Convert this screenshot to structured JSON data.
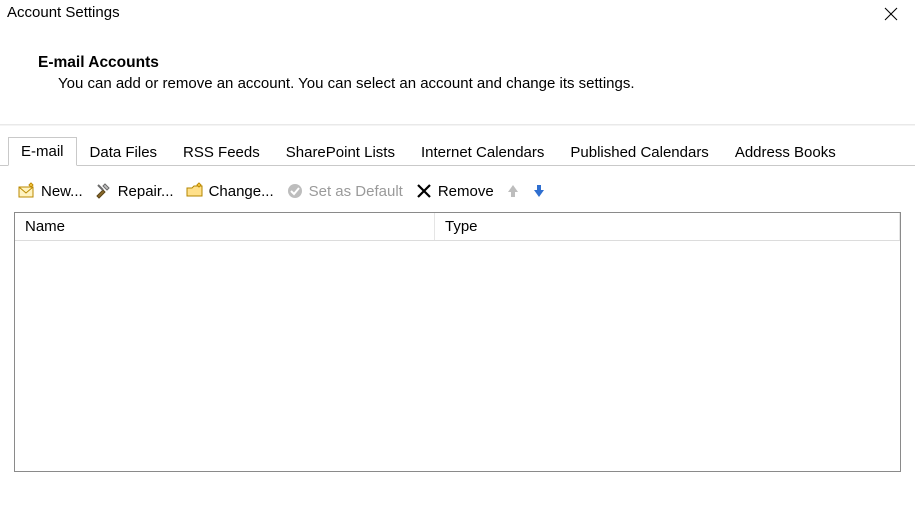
{
  "window": {
    "title": "Account Settings"
  },
  "header": {
    "title": "E-mail Accounts",
    "description": "You can add or remove an account. You can select an account and change its settings."
  },
  "tabs": [
    {
      "label": "E-mail",
      "active": true
    },
    {
      "label": "Data Files"
    },
    {
      "label": "RSS Feeds"
    },
    {
      "label": "SharePoint Lists"
    },
    {
      "label": "Internet Calendars"
    },
    {
      "label": "Published Calendars"
    },
    {
      "label": "Address Books"
    }
  ],
  "toolbar": {
    "new_label": "New...",
    "repair_label": "Repair...",
    "change_label": "Change...",
    "set_default_label": "Set as Default",
    "remove_label": "Remove"
  },
  "grid": {
    "columns": {
      "name_label": "Name",
      "type_label": "Type"
    },
    "rows": []
  }
}
